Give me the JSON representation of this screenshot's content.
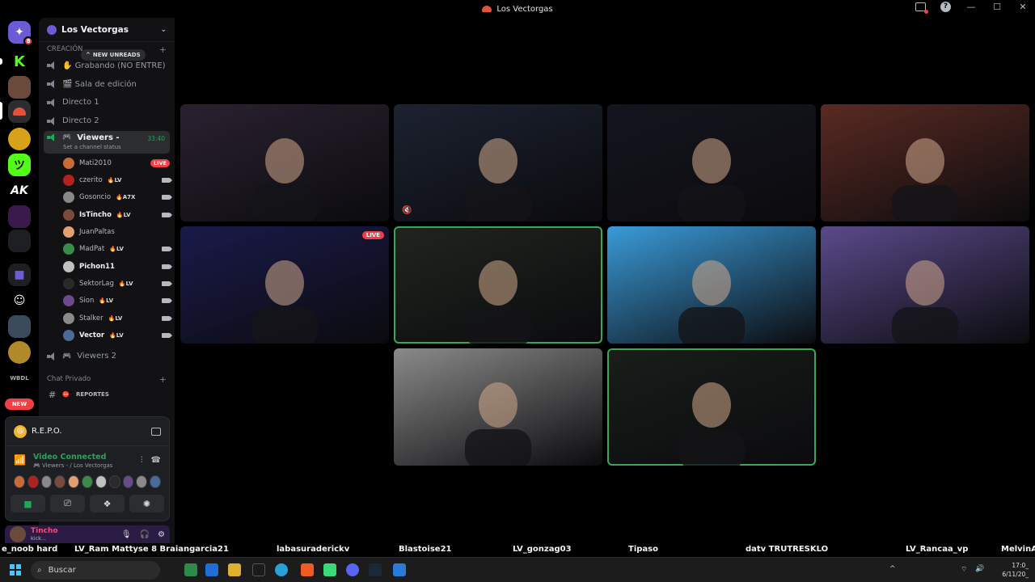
{
  "window": {
    "title": "Los Vectorgas"
  },
  "rail": {
    "new_badge": "NEW",
    "mention_count": "8"
  },
  "guild": {
    "name": "Los Vectorgas",
    "category_label": "CREACIÓN",
    "new_unreads": "NEW UNREADS",
    "channels": [
      {
        "label": "✋ Grabando (NO ENTRE)"
      },
      {
        "label": "🎬 Sala de edición"
      },
      {
        "label": "Directo 1"
      },
      {
        "label": "Directo 2"
      }
    ],
    "active_channel": {
      "label": "Viewers -",
      "status": "Set a channel status",
      "timer": "33:40"
    },
    "members": [
      {
        "name": "Mati2010",
        "tag": "",
        "live": "LIVE",
        "cam": false,
        "color": "#c86a3a"
      },
      {
        "name": "czerito",
        "tag": "LV",
        "live": "",
        "cam": true,
        "color": "#b32020"
      },
      {
        "name": "Gosoncio",
        "tag": "A7X",
        "live": "",
        "cam": true,
        "color": "#888888"
      },
      {
        "name": "IsTincho",
        "tag": "LV",
        "live": "",
        "cam": true,
        "color": "#7a4a3a"
      },
      {
        "name": "JuanPaltas",
        "tag": "",
        "live": "",
        "cam": false,
        "color": "#e0a070"
      },
      {
        "name": "MadPat",
        "tag": "LV",
        "live": "",
        "cam": true,
        "color": "#3a8a4a"
      },
      {
        "name": "Pichon11",
        "tag": "",
        "live": "",
        "cam": true,
        "color": "#c0c0c0"
      },
      {
        "name": "SektorLag",
        "tag": "LV",
        "live": "",
        "cam": true,
        "color": "#2a2a2a"
      },
      {
        "name": "Sion",
        "tag": "LV",
        "live": "",
        "cam": true,
        "color": "#6a4a8a"
      },
      {
        "name": "Stalker",
        "tag": "LV",
        "live": "",
        "cam": true,
        "color": "#8a8a8a"
      },
      {
        "name": "Vector",
        "tag": "LV",
        "live": "",
        "cam": true,
        "color": "#4a6a9a"
      }
    ],
    "viewers2": "Viewers 2",
    "private_category": "Chat Privado",
    "rules_channel": "REPORTES"
  },
  "voice_panel": {
    "activity": "R.E.P.O.",
    "status": "Video Connected",
    "channel_path": "🎮 Viewers - / Los Vectorgas"
  },
  "user": {
    "name": "Tincho",
    "status": "kick..."
  },
  "overlay_names": [
    {
      "text": "e_noob hard"
    },
    {
      "text": "LV_Ram  Mattyse 8  Braiangarcia21"
    },
    {
      "text": "labasuraderickv"
    },
    {
      "text": "Blastoise21"
    },
    {
      "text": "LV_gonzag03"
    },
    {
      "text": "Tipaso"
    },
    {
      "text": "datv TRUTRESKLO"
    },
    {
      "text": "LV_Rancaa_vp"
    },
    {
      "text": "MelvinA"
    }
  ],
  "video_tiles": [
    {
      "label": "tile-1",
      "speaking": false,
      "live": "",
      "muted": false,
      "bg": "#2a2130"
    },
    {
      "label": "tile-2",
      "speaking": false,
      "live": "",
      "muted": true,
      "bg": "#1c2230"
    },
    {
      "label": "tile-3",
      "speaking": false,
      "live": "",
      "muted": false,
      "bg": "#15151f"
    },
    {
      "label": "tile-4",
      "speaking": false,
      "live": "",
      "muted": false,
      "bg": "#5a2a22"
    },
    {
      "label": "tile-5",
      "speaking": false,
      "live": "LIVE",
      "muted": false,
      "bg": "#1a1a4a"
    },
    {
      "label": "tile-6",
      "speaking": true,
      "live": "",
      "muted": false,
      "bg": "#20251e"
    },
    {
      "label": "tile-7",
      "speaking": false,
      "live": "",
      "muted": false,
      "bg": "#3a9ad8"
    },
    {
      "label": "tile-8",
      "speaking": false,
      "live": "",
      "muted": false,
      "bg": "#5a4a8a"
    },
    {
      "label": "tile-9",
      "speaking": false,
      "live": "",
      "muted": false,
      "bg": "#8a8a8a"
    },
    {
      "label": "tile-10",
      "speaking": true,
      "live": "",
      "muted": false,
      "bg": "#1a1d1a"
    }
  ],
  "taskbar": {
    "search_placeholder": "Buscar",
    "time": "17:0_",
    "date": "6/11/20_"
  },
  "colors": {
    "accent_green": "#23a55a",
    "live_red": "#f23f43",
    "sidebar_bg": "#121214"
  }
}
